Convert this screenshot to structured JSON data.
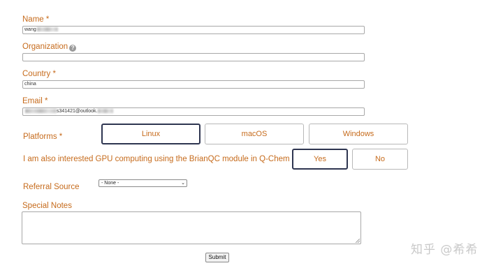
{
  "form": {
    "name": {
      "label": "Name",
      "required": "*",
      "value": "wang"
    },
    "organization": {
      "label": "Organization",
      "help_icon": "?",
      "value": ""
    },
    "country": {
      "label": "Country",
      "required": "*",
      "value": "china"
    },
    "email": {
      "label": "Email",
      "required": "*",
      "value_prefix": "",
      "value_visible": "s341421@outlook.",
      "value_suffix": ""
    },
    "platforms": {
      "label": "Platforms",
      "required": "*",
      "options": [
        "Linux",
        "macOS",
        "Windows"
      ],
      "selected": "Linux"
    },
    "gpu": {
      "label": "I am also interested GPU computing using the BrianQC module in Q-Chem",
      "options": [
        "Yes",
        "No"
      ],
      "selected": "Yes"
    },
    "referral": {
      "label": "Referral Source",
      "selected": "- None -",
      "arrow_icon": "chevron-down-icon"
    },
    "notes": {
      "label": "Special Notes",
      "value": ""
    },
    "submit_label": "Submit"
  },
  "watermark": "知乎 @希希",
  "colors": {
    "label": "#c66b1c",
    "selected_border": "#2e3550",
    "input_border": "#a8a8a8"
  }
}
